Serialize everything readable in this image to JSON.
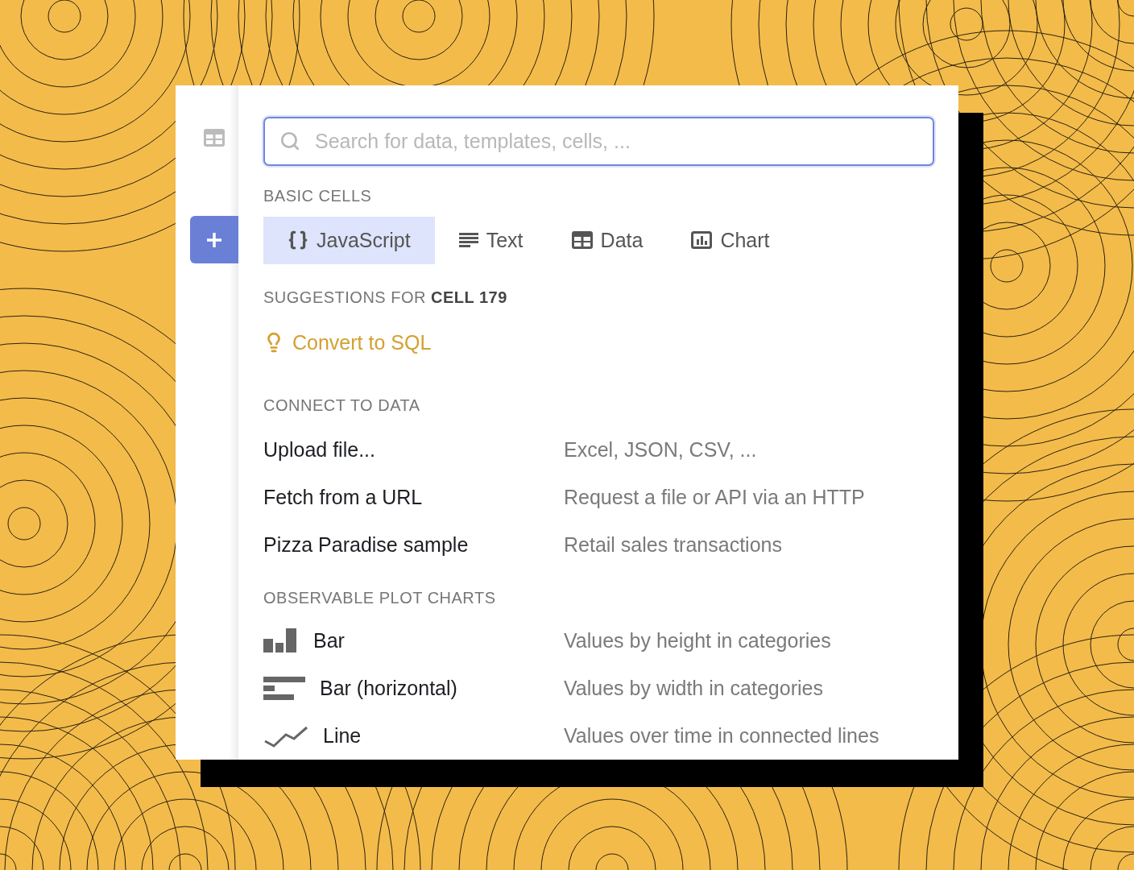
{
  "search": {
    "placeholder": "Search for data, templates, cells, ..."
  },
  "basic_cells": {
    "heading": "BASIC CELLS",
    "tabs": [
      {
        "kind": "javascript",
        "label": "JavaScript",
        "selected": true
      },
      {
        "kind": "text",
        "label": "Text",
        "selected": false
      },
      {
        "kind": "data",
        "label": "Data",
        "selected": false
      },
      {
        "kind": "chart",
        "label": "Chart",
        "selected": false
      }
    ]
  },
  "suggestions": {
    "heading": "SUGGESTIONS FOR **CELL 179**",
    "items": [
      {
        "label": "Convert to SQL"
      }
    ]
  },
  "connect_to_data": {
    "heading": "CONNECT TO DATA",
    "items": [
      {
        "label": "Upload file...",
        "description": "Excel, JSON, CSV, ..."
      },
      {
        "label": "Fetch from a URL",
        "description": "Request a file or API via an HTTP"
      },
      {
        "label": "Pizza Paradise sample",
        "description": "Retail sales transactions"
      }
    ]
  },
  "plot_charts": {
    "heading": "OBSERVABLE PLOT CHARTS",
    "items": [
      {
        "kind": "bar",
        "label": "Bar",
        "description": "Values by height in categories"
      },
      {
        "kind": "bar-horizontal",
        "label": "Bar (horizontal)",
        "description": "Values by width in categories"
      },
      {
        "kind": "line",
        "label": "Line",
        "description": "Values over time in connected lines"
      }
    ]
  }
}
